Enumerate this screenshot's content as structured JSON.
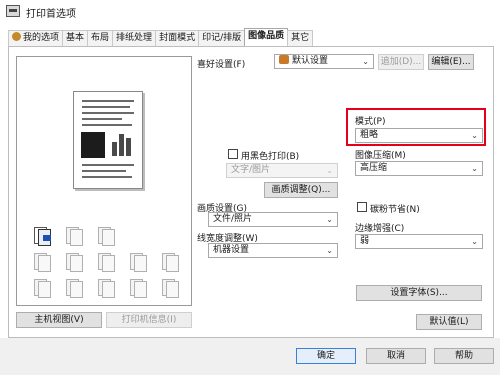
{
  "window": {
    "title": "打印首选项"
  },
  "tabs": [
    {
      "label": "我的选项"
    },
    {
      "label": "基本"
    },
    {
      "label": "布局"
    },
    {
      "label": "排纸处理"
    },
    {
      "label": "封面模式"
    },
    {
      "label": "印记/排版"
    },
    {
      "label": "图像品质",
      "active": true
    },
    {
      "label": "其它"
    }
  ],
  "left_panel": {
    "host_view_button": "主机视图(V)",
    "printer_info_button": "打印机信息(I)"
  },
  "favorites": {
    "label": "喜好设置(F)",
    "value": "默认设置",
    "add_button": "追加(D)...",
    "edit_button": "编辑(E)..."
  },
  "color": {
    "bw_print_label": "用黑色打印(B)",
    "bw_mode_value": "文字/图片",
    "quality_adjust_button": "画质调整(Q)..."
  },
  "image_settings": {
    "label": "画质设置(G)",
    "value": "文件/照片"
  },
  "line_width": {
    "label": "线宽度调整(W)",
    "value": "机器设置"
  },
  "mode": {
    "label": "模式(P)",
    "value": "粗略"
  },
  "compression": {
    "label": "图像压缩(M)",
    "value": "高压缩"
  },
  "toner_save": {
    "label": "碳粉节省(N)"
  },
  "edge_enhance": {
    "label": "边缘增强(C)",
    "value": "弱"
  },
  "font_settings_button": "设置字体(S)...",
  "default_button": "默认值(L)",
  "footer": {
    "ok": "确定",
    "cancel": "取消",
    "help": "帮助"
  },
  "icons": {
    "highlight_color": "#e3001b",
    "accent": "#1e50b4"
  }
}
